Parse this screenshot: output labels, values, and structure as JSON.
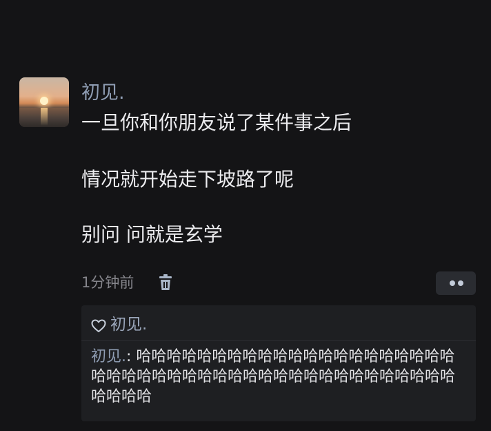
{
  "post": {
    "author": "初见.",
    "lines": [
      "一旦你和你朋友说了某件事之后",
      "情况就开始走下坡路了呢",
      "别问 问就是玄学"
    ],
    "timestamp": "1分钟前",
    "actions": {
      "delete_icon": "trash-icon",
      "more_icon": "more-dots-icon"
    }
  },
  "likes": {
    "icon": "heart-icon",
    "names": "初见."
  },
  "replies": [
    {
      "author": "初见.",
      "separator": ": ",
      "text": "哈哈哈哈哈哈哈哈哈哈哈哈哈哈哈哈哈哈哈哈哈哈哈哈哈哈哈哈哈哈哈哈哈哈哈哈哈哈哈哈哈哈哈哈哈哈哈哈哈"
    }
  ],
  "colors": {
    "background": "#141416",
    "name_accent": "#8f9db3",
    "reply_background": "#1e1f22"
  }
}
